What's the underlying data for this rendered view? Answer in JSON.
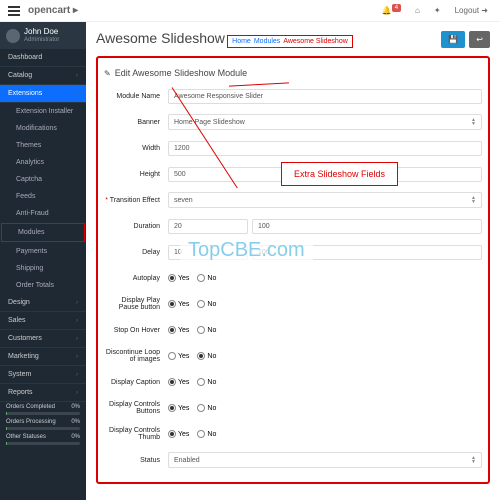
{
  "brand": {
    "name": "opencart",
    "suffix": "▸"
  },
  "topbar": {
    "notif": "4",
    "logout": "Logout"
  },
  "user": {
    "name": "John Doe",
    "role": "Administrator"
  },
  "nav": {
    "dashboard": "Dashboard",
    "catalog": "Catalog",
    "extensions": "Extensions",
    "design": "Design",
    "sales": "Sales",
    "customers": "Customers",
    "marketing": "Marketing",
    "system": "System",
    "reports": "Reports"
  },
  "ext_sub": {
    "installer": "Extension Installer",
    "modifications": "Modifications",
    "themes": "Themes",
    "analytics": "Analytics",
    "captcha": "Captcha",
    "feeds": "Feeds",
    "antifraud": "Anti-Fraud",
    "modules": "Modules",
    "payments": "Payments",
    "shipping": "Shipping",
    "ordertotals": "Order Totals"
  },
  "stats": {
    "completed": {
      "label": "Orders Completed",
      "val": "0%"
    },
    "processing": {
      "label": "Orders Processing",
      "val": "0%"
    },
    "other": {
      "label": "Other Statuses",
      "val": "0%"
    }
  },
  "page": {
    "title": "Awesome Slideshow",
    "panel_title": "Edit Awesome Slideshow Module"
  },
  "crumbs": {
    "home": "Home",
    "modules": "Modules",
    "current": "Awesome Slideshow"
  },
  "callout": "Extra Slideshow Fields",
  "form": {
    "module_name": {
      "label": "Module Name",
      "value": "Awesome Responsive Slider"
    },
    "banner": {
      "label": "Banner",
      "value": "Home Page Slideshow"
    },
    "width": {
      "label": "Width",
      "value": "1200"
    },
    "height": {
      "label": "Height",
      "value": "500"
    },
    "transition": {
      "label": "Transition Effect",
      "value": "seven"
    },
    "duration": {
      "label": "Duration",
      "v1": "20",
      "v2": "100"
    },
    "delay": {
      "label": "Delay",
      "v1": "10",
      "v2": "100"
    },
    "autoplay": {
      "label": "Autoplay",
      "yes": "Yes",
      "no": "No"
    },
    "playpause": {
      "label": "Display Play Pause button",
      "yes": "Yes",
      "no": "No"
    },
    "stophover": {
      "label": "Stop On Hover",
      "yes": "Yes",
      "no": "No"
    },
    "discont": {
      "label": "Discontinue Loop of images",
      "yes": "Yes",
      "no": "No"
    },
    "caption": {
      "label": "Display Caption",
      "yes": "Yes",
      "no": "No"
    },
    "ctrlbtn": {
      "label": "Display Controls Buttons",
      "yes": "Yes",
      "no": "No"
    },
    "ctrlthumb": {
      "label": "Display Controls Thumb",
      "yes": "Yes",
      "no": "No"
    },
    "status": {
      "label": "Status",
      "value": "Enabled"
    }
  },
  "watermark": "TopCBE.com"
}
